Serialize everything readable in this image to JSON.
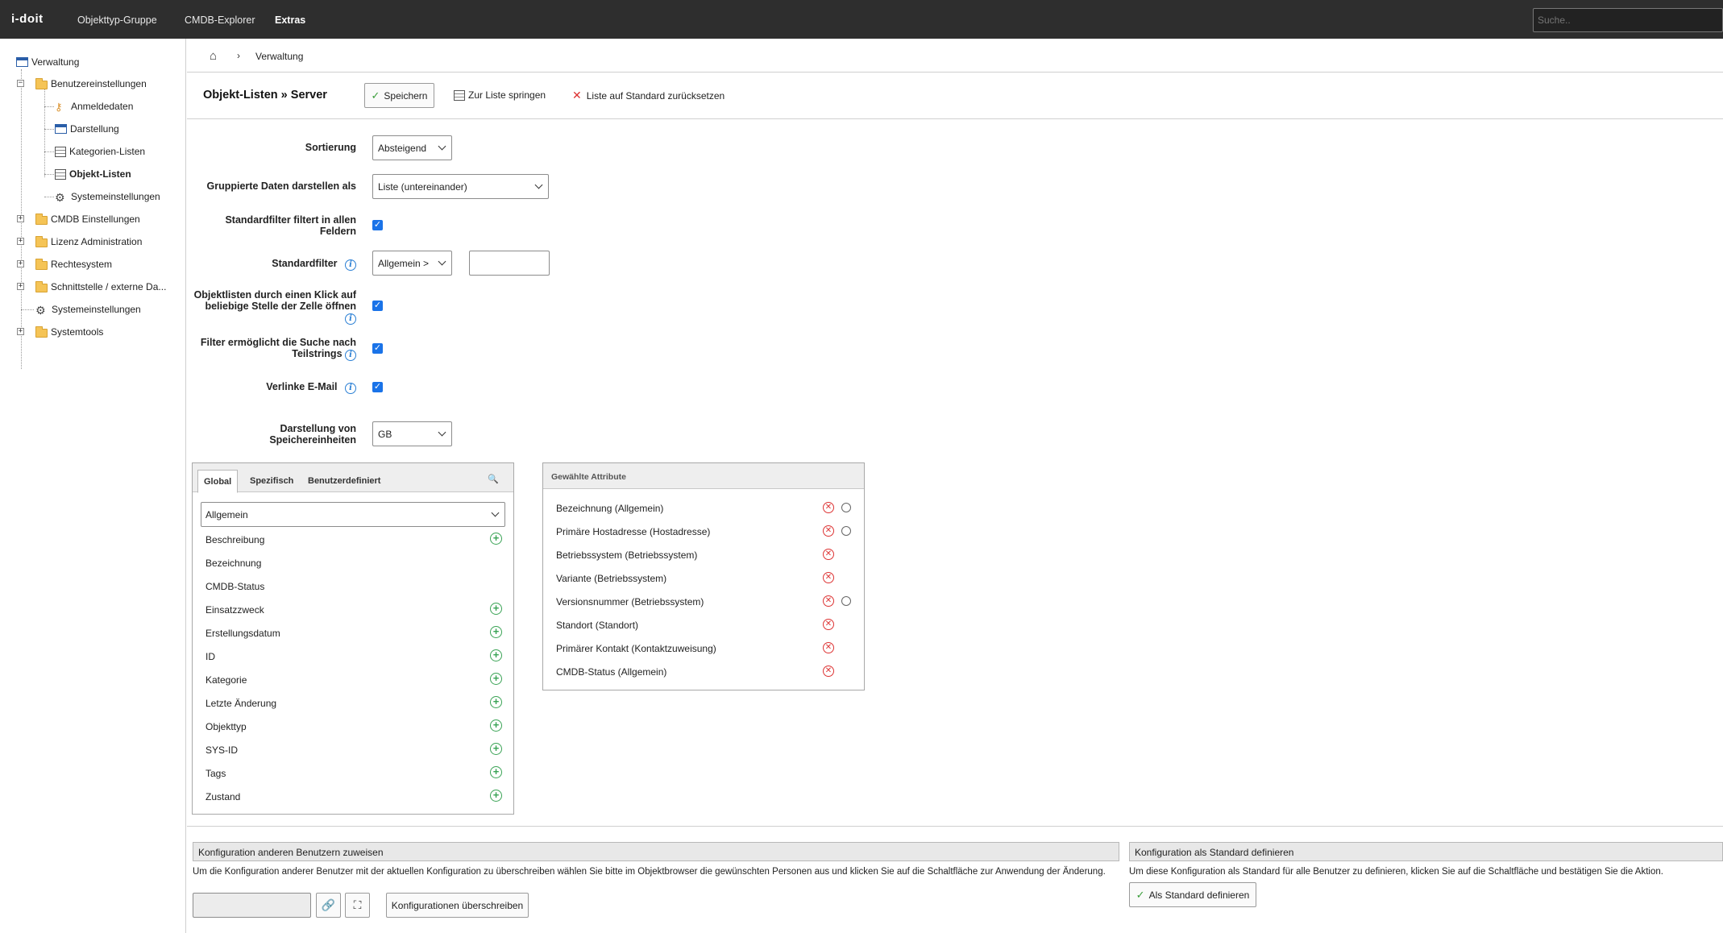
{
  "topbar": {
    "logo": "i-doit",
    "nav": [
      "Objekttyp-Gruppe",
      "CMDB-Explorer",
      "Extras"
    ],
    "search_placeholder": "Suche.."
  },
  "sidebar": {
    "root": "Verwaltung",
    "items": [
      {
        "label": "Benutzereinstellungen",
        "icon": "folder-icon"
      },
      {
        "label": "Anmeldedaten",
        "icon": "key-icon"
      },
      {
        "label": "Darstellung",
        "icon": "window-icon"
      },
      {
        "label": "Kategorien-Listen",
        "icon": "table-icon"
      },
      {
        "label": "Objekt-Listen",
        "icon": "table-icon"
      },
      {
        "label": "Systemeinstellungen",
        "icon": "gear-icon"
      },
      {
        "label": "CMDB Einstellungen",
        "icon": "folder-icon"
      },
      {
        "label": "Lizenz Administration",
        "icon": "folder-icon"
      },
      {
        "label": "Rechtesystem",
        "icon": "folder-icon"
      },
      {
        "label": "Schnittstelle / externe Da...",
        "icon": "folder-icon"
      },
      {
        "label": "Systemeinstellungen",
        "icon": "gear-icon"
      },
      {
        "label": "Systemtools",
        "icon": "folder-icon"
      }
    ]
  },
  "breadcrumb": {
    "current": "Verwaltung"
  },
  "header": {
    "title": "Objekt-Listen » Server",
    "save_label": "Speichern",
    "jump_label": "Zur Liste springen",
    "reset_label": "Liste auf Standard zurücksetzen"
  },
  "form": {
    "sortierung_label": "Sortierung",
    "sortierung_value": "Absteigend",
    "gruppiert_label": "Gruppierte Daten darstellen als",
    "gruppiert_value": "Liste (untereinander)",
    "standardfilter_alle_label": "Standardfilter filtert in allen Feldern",
    "standardfilter_label": "Standardfilter",
    "standardfilter_value": "Allgemein >",
    "klick_label": "Objektlisten durch einen Klick auf beliebige Stelle der Zelle öffnen",
    "teilstrings_label": "Filter ermöglicht die Suche nach Teilstrings",
    "email_label": "Verlinke E-Mail",
    "speicher_label": "Darstellung von Speichereinheiten",
    "speicher_value": "GB"
  },
  "available": {
    "tabs": [
      "Global",
      "Spezifisch",
      "Benutzerdefiniert"
    ],
    "category": "Allgemein",
    "items": [
      "Beschreibung",
      "Bezeichnung",
      "CMDB-Status",
      "Einsatzzweck",
      "Erstellungsdatum",
      "ID",
      "Kategorie",
      "Letzte Änderung",
      "Objekttyp",
      "SYS-ID",
      "Tags",
      "Zustand"
    ]
  },
  "selected": {
    "title": "Gewählte Attribute",
    "items": [
      "Bezeichnung (Allgemein)",
      "Primäre Hostadresse (Hostadresse)",
      "Betriebssystem (Betriebssystem)",
      "Variante (Betriebssystem)",
      "Versionsnummer (Betriebssystem)",
      "Standort (Standort)",
      "Primärer Kontakt (Kontaktzuweisung)",
      "CMDB-Status (Allgemein)"
    ]
  },
  "assign": {
    "title": "Konfiguration anderen Benutzern zuweisen",
    "text": "Um die Konfiguration anderer Benutzer mit der aktuellen Konfiguration zu überschreiben wählen Sie bitte im Objektbrowser die gewünschten Personen aus und klicken Sie auf die Schaltfläche zur Anwendung der Änderung.",
    "button": "Konfigurationen überschreiben"
  },
  "default": {
    "title": "Konfiguration als Standard definieren",
    "text": "Um diese Konfiguration als Standard für alle Benutzer zu definieren, klicken Sie auf die Schaltfläche und bestätigen Sie die Aktion.",
    "button": "Als Standard definieren"
  },
  "colors": {
    "topbar": "#2e2e2e",
    "accent": "#1a73e8",
    "add": "#3aa355",
    "remove": "#dd3333"
  }
}
